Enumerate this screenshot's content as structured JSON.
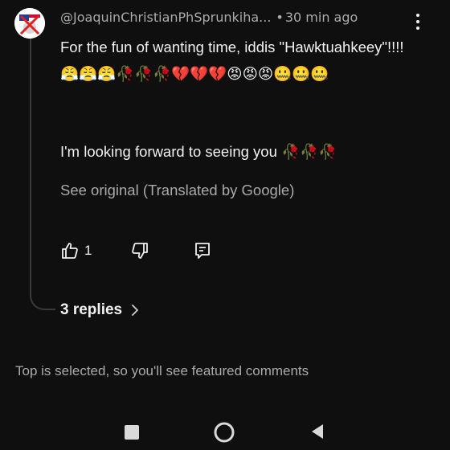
{
  "comment": {
    "author": "@JoaquinChristianPhSprunkiha...",
    "separator": "•",
    "timestamp": "30 min ago",
    "text_main": "For the fun of wanting time, iddis \"Hawktuahkeey\"!!!! 😤😤😤🥀🥀🥀💔💔💔😡😡😡🤐🤐🤐",
    "text_second": "I'm looking forward to seeing you 🥀🥀🥀",
    "see_original": "See original (Translated by Google)",
    "like_count": "1",
    "replies_label": "3 replies"
  },
  "footer": {
    "note": "Top is selected, so you'll see featured comments"
  },
  "icons": {
    "like": "thumb-up-icon",
    "dislike": "thumb-down-icon",
    "reply": "reply-comment-icon",
    "menu": "more-vert-icon",
    "chevron": "chevron-right-icon",
    "nav_recents": "recents-square-icon",
    "nav_home": "home-circle-icon",
    "nav_back": "back-triangle-icon"
  },
  "colors": {
    "background": "#0f0f0f",
    "primary_text": "#f1f1f1",
    "secondary_text": "#aaaaaa"
  }
}
